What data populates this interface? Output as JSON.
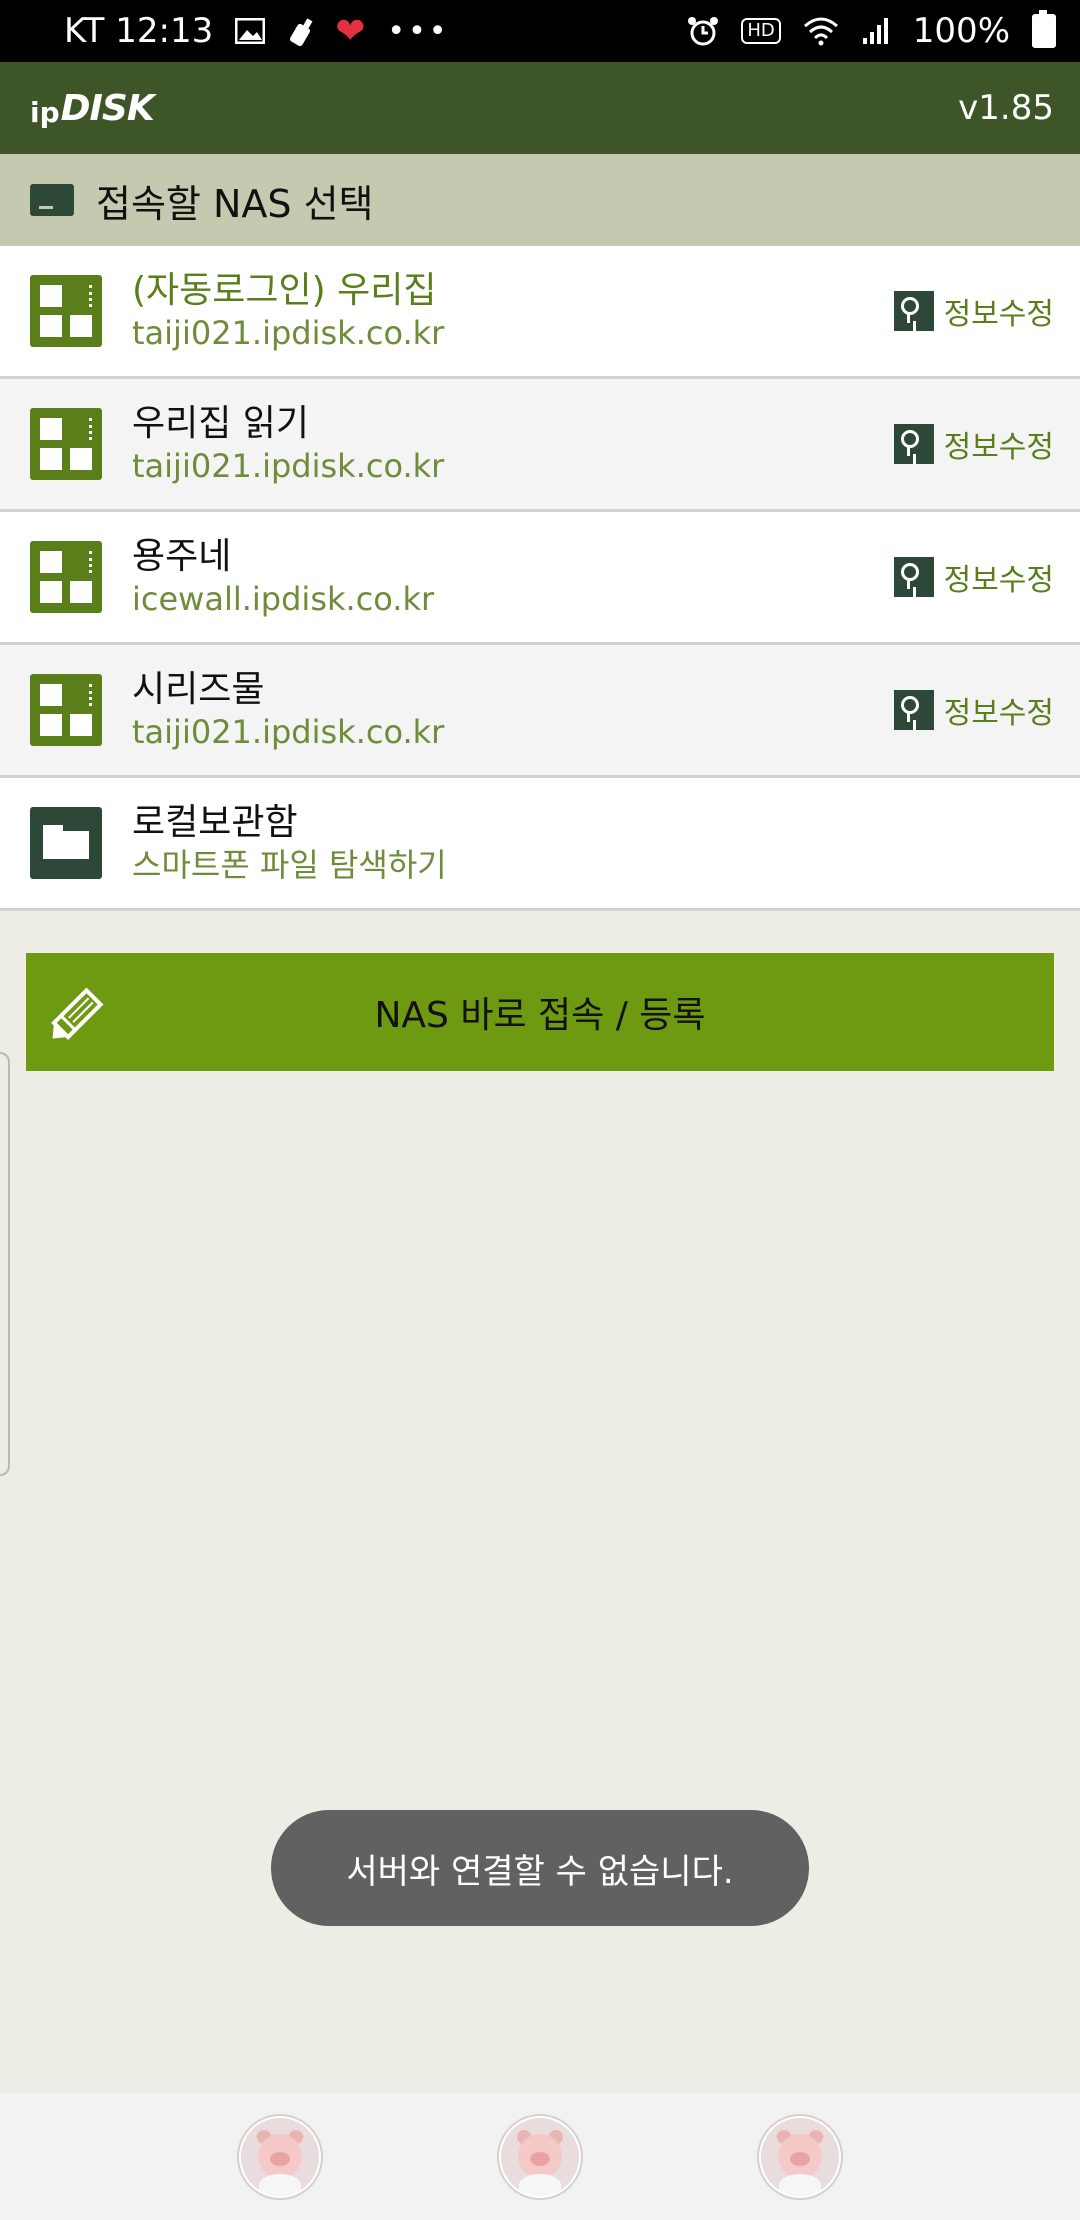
{
  "status_bar": {
    "carrier_time": "KT 12:13",
    "battery": "100%",
    "hd_label": "HD",
    "icons": [
      "image-icon",
      "bottle-icon",
      "heart-icon",
      "more-icon",
      "alarm-icon",
      "hd-voice-icon",
      "wifi-icon",
      "signal-icon",
      "battery-icon"
    ]
  },
  "header": {
    "logo_ip": "ip",
    "logo_disk": "DISK",
    "version": "v1.85"
  },
  "section": {
    "title": "접속할 NAS 선택"
  },
  "list": {
    "items": [
      {
        "title": "(자동로그인) 우리집",
        "subtitle": "taiji021.ipdisk.co.kr",
        "edit_label": "정보수정"
      },
      {
        "title": "우리집 읽기",
        "subtitle": "taiji021.ipdisk.co.kr",
        "edit_label": "정보수정"
      },
      {
        "title": "용주네",
        "subtitle": "icewall.ipdisk.co.kr",
        "edit_label": "정보수정"
      },
      {
        "title": "시리즈물",
        "subtitle": "taiji021.ipdisk.co.kr",
        "edit_label": "정보수정"
      },
      {
        "title": "로컬보관함",
        "subtitle": "스마트폰 파일 탐색하기"
      }
    ]
  },
  "main_button": {
    "label": "NAS 바로 접속 / 등록"
  },
  "toast": {
    "message": "서버와 연결할 수 없습니다."
  },
  "colors": {
    "header": "#3e5528",
    "section": "#c4c9b0",
    "accent": "#6e9a12",
    "link": "#5a7e1a",
    "background": "#edede6"
  }
}
